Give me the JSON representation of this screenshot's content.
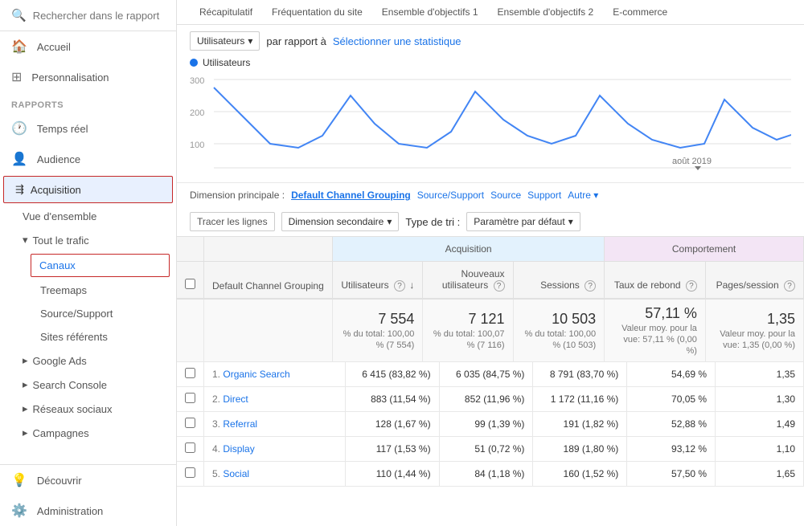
{
  "sidebar": {
    "search_placeholder": "Rechercher dans le rapport",
    "nav_items": [
      {
        "label": "Accueil",
        "icon": "🏠"
      },
      {
        "label": "Personnalisation",
        "icon": "⊞"
      }
    ],
    "rapports_label": "RAPPORTS",
    "rapports_items": [
      {
        "label": "Temps réel",
        "icon": "🕐"
      },
      {
        "label": "Audience",
        "icon": "👤"
      },
      {
        "label": "Acquisition",
        "icon": "⇶",
        "active": true
      },
      {
        "label": "Vue d'ensemble",
        "sub": true,
        "level": 1
      },
      {
        "label": "Tout le trafic",
        "sub": true,
        "level": 1,
        "expanded": true
      },
      {
        "label": "Canaux",
        "sub": true,
        "level": 2,
        "highlighted": true
      },
      {
        "label": "Treemaps",
        "sub": true,
        "level": 2
      },
      {
        "label": "Source/Support",
        "sub": true,
        "level": 2
      },
      {
        "label": "Sites référents",
        "sub": true,
        "level": 2
      },
      {
        "label": "Google Ads",
        "sub": true,
        "level": 1,
        "collapsible": true
      },
      {
        "label": "Search Console",
        "sub": true,
        "level": 1,
        "collapsible": true
      },
      {
        "label": "Réseaux sociaux",
        "sub": true,
        "level": 1,
        "collapsible": true
      },
      {
        "label": "Campagnes",
        "sub": true,
        "level": 1,
        "collapsible": true
      }
    ],
    "bottom_items": [
      {
        "label": "Découvrir",
        "icon": "💡"
      },
      {
        "label": "Administration",
        "icon": "⚙️"
      }
    ]
  },
  "tabs": [
    {
      "label": "Récapitulatif"
    },
    {
      "label": "Fréquentation du site"
    },
    {
      "label": "Ensemble d'objectifs 1"
    },
    {
      "label": "Ensemble d'objectifs 2"
    },
    {
      "label": "E-commerce"
    }
  ],
  "chart": {
    "y_labels": [
      "300",
      "200",
      "100"
    ],
    "legend": "Utilisateurs",
    "date_label": "août 2019",
    "dropdown_label": "Utilisateurs",
    "compare_label": "par rapport à",
    "select_stat_label": "Sélectionner une statistique"
  },
  "dimension": {
    "label": "Dimension principale :",
    "options": [
      {
        "label": "Default Channel Grouping",
        "active": true
      },
      {
        "label": "Source/Support"
      },
      {
        "label": "Source"
      },
      {
        "label": "Support"
      },
      {
        "label": "Autre"
      }
    ]
  },
  "filters": {
    "trace_label": "Tracer les lignes",
    "secondary_dim_label": "Dimension secondaire",
    "sort_type_label": "Type de tri :",
    "sort_default_label": "Paramètre par défaut"
  },
  "table": {
    "col_channel": "Default Channel Grouping",
    "acquisition_header": "Acquisition",
    "comportement_header": "Comportement",
    "col_users": "Utilisateurs",
    "col_new_users": "Nouveaux utilisateurs",
    "col_sessions": "Sessions",
    "col_bounce": "Taux de rebond",
    "col_pages": "Pages/session",
    "totals": {
      "users": "7 554",
      "users_pct": "% du total: 100,00 % (7 554)",
      "new_users": "7 121",
      "new_users_pct": "% du total: 100,07 % (7 116)",
      "sessions": "10 503",
      "sessions_pct": "% du total: 100,00 % (10 503)",
      "bounce": "57,11 %",
      "bounce_sub": "Valeur moy. pour la vue: 57,11 % (0,00 %)",
      "pages": "1,35",
      "pages_sub": "Valeur moy. pour la vue: 1,35 (0,00 %)"
    },
    "rows": [
      {
        "num": "1.",
        "channel": "Organic Search",
        "users": "6 415 (83,82 %)",
        "new_users": "6 035 (84,75 %)",
        "sessions": "8 791 (83,70 %)",
        "bounce": "54,69 %",
        "pages": "1,35"
      },
      {
        "num": "2.",
        "channel": "Direct",
        "users": "883 (11,54 %)",
        "new_users": "852 (11,96 %)",
        "sessions": "1 172 (11,16 %)",
        "bounce": "70,05 %",
        "pages": "1,30"
      },
      {
        "num": "3.",
        "channel": "Referral",
        "users": "128 (1,67 %)",
        "new_users": "99 (1,39 %)",
        "sessions": "191 (1,82 %)",
        "bounce": "52,88 %",
        "pages": "1,49"
      },
      {
        "num": "4.",
        "channel": "Display",
        "users": "117 (1,53 %)",
        "new_users": "51 (0,72 %)",
        "sessions": "189 (1,80 %)",
        "bounce": "93,12 %",
        "pages": "1,10"
      },
      {
        "num": "5.",
        "channel": "Social",
        "users": "110 (1,44 %)",
        "new_users": "84 (1,18 %)",
        "sessions": "160 (1,52 %)",
        "bounce": "57,50 %",
        "pages": "1,65"
      }
    ]
  }
}
